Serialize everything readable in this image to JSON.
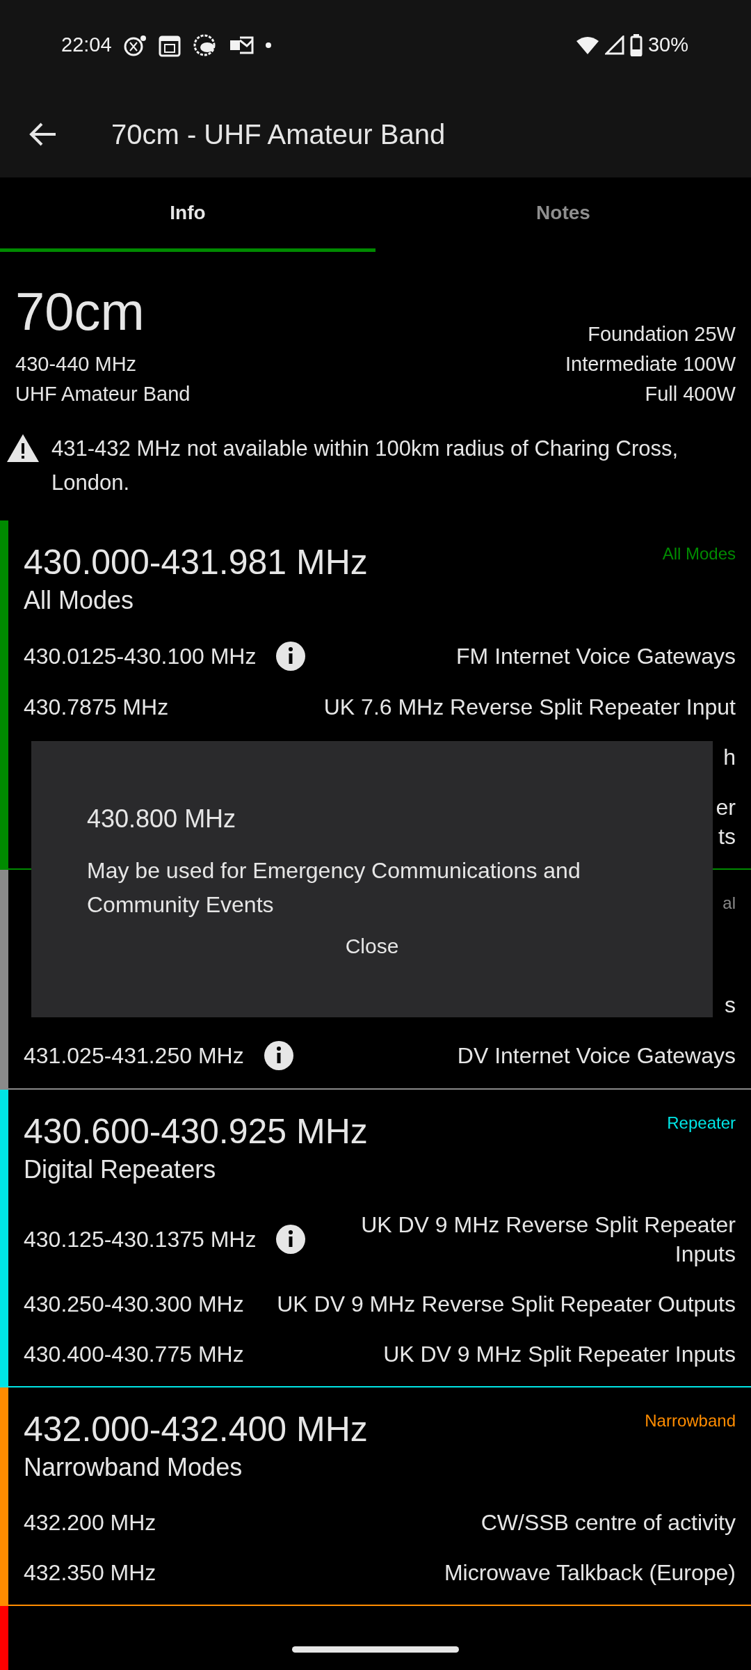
{
  "status_bar": {
    "time": "22:04",
    "battery": "30%"
  },
  "app_bar": {
    "title": "70cm - UHF Amateur Band"
  },
  "tabs": [
    {
      "label": "Info",
      "selected": true
    },
    {
      "label": "Notes",
      "selected": false
    }
  ],
  "band": {
    "name": "70cm",
    "range": "430-440 MHz",
    "description": "UHF Amateur Band",
    "licences": [
      "Foundation 25W",
      "Intermediate 100W",
      "Full 400W"
    ]
  },
  "warning": "431-432 MHz not available within 100km radius of Charing Cross, London.",
  "segments": [
    {
      "color": "#008a00",
      "tag": "All Modes",
      "range": "430.000-431.981 MHz",
      "description": "All Modes",
      "rows": [
        {
          "frequency": "430.0125-430.100 MHz",
          "info": true,
          "use": "FM Internet Voice Gateways"
        },
        {
          "frequency": "430.7875 MHz",
          "info": false,
          "use": "UK 7.6 MHz Reverse Split Repeater Input"
        },
        {
          "info": false,
          "use": "h"
        },
        {
          "info": false,
          "use": "er\nts"
        }
      ]
    },
    {
      "color": "#8a8a8a",
      "tag": "al",
      "rows": [
        {
          "info": false,
          "use": "s"
        },
        {
          "frequency": "431.025-431.250 MHz",
          "info": true,
          "use": "DV Internet Voice Gateways"
        }
      ]
    },
    {
      "color": "#00e5e5",
      "tag": "Repeater",
      "range": "430.600-430.925 MHz",
      "description": "Digital Repeaters",
      "rows": [
        {
          "frequency": "430.125-430.1375 MHz",
          "info": true,
          "use": "UK DV 9 MHz Reverse Split Repeater Inputs"
        },
        {
          "frequency": "430.250-430.300 MHz",
          "info": false,
          "use": "UK DV 9 MHz Reverse Split Repeater Outputs"
        },
        {
          "frequency": "430.400-430.775 MHz",
          "info": false,
          "use": "UK DV 9 MHz Split Repeater Inputs"
        }
      ]
    },
    {
      "color": "#ff8c00",
      "tag": "Narrowband",
      "range": "432.000-432.400 MHz",
      "description": "Narrowband Modes",
      "rows": [
        {
          "frequency": "432.200 MHz",
          "info": false,
          "use": "CW/SSB centre of activity"
        },
        {
          "frequency": "432.350 MHz",
          "info": false,
          "use": "Microwave Talkback (Europe)"
        }
      ]
    },
    {
      "color": "#ff0000"
    }
  ],
  "dialog": {
    "title": "430.800 MHz",
    "message": "May be used for Emergency Communications and Community Events",
    "button": "Close"
  }
}
